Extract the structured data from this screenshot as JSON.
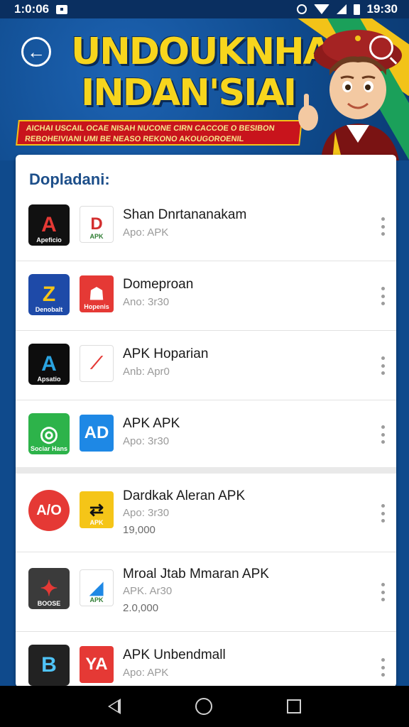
{
  "status_bar": {
    "time_left": "1:0:06",
    "time_right": "19:30"
  },
  "banner": {
    "title_line1": "UNDOUKNHAN",
    "title_line2": "INDAN'SIAI",
    "ribbon_line1": "AICHAI USCAIL OCAE NISAH NUCONE CIRN CACCOE O BESIBON",
    "ribbon_line2": "REBOHEIVIANI UMI BE NEASO REKONO AKOUGOROENIL"
  },
  "list": {
    "title": "Dopladani:",
    "items": [
      {
        "name": "Shan Dnrtananakam",
        "sub": "Apo: APK",
        "size": "",
        "icon_a": {
          "text": "A",
          "caption": "Apeficio",
          "bg": "#111111",
          "fg": "#e53935"
        },
        "icon_b": {
          "text": "D",
          "caption": "APK",
          "bg": "#ffffff",
          "fg": "#d32f2f"
        }
      },
      {
        "name": "Domeproan",
        "sub": "Ano: 3r30",
        "size": "",
        "icon_a": {
          "text": "Z",
          "caption": "Denobalt",
          "bg": "#1e4aa8",
          "fg": "#f5c518"
        },
        "icon_b": {
          "text": "☗",
          "caption": "Hopenis",
          "bg": "#e53935",
          "fg": "#ffffff"
        }
      },
      {
        "name": "APK Hoparian",
        "sub": "Anb: Apr0",
        "size": "",
        "icon_a": {
          "text": "A",
          "caption": "Apsatio",
          "bg": "#0d0d0d",
          "fg": "#2aa3e0"
        },
        "icon_b": {
          "text": "⟋",
          "caption": "",
          "bg": "#ffffff",
          "fg": "#e53935"
        }
      },
      {
        "name": "APK APK",
        "sub": "Apo: 3r30",
        "size": "",
        "icon_a": {
          "text": "◎",
          "caption": "Sociar Hans",
          "bg": "#2db34a",
          "fg": "#ffffff"
        },
        "icon_b": {
          "text": "AD",
          "caption": "",
          "bg": "#1e88e5",
          "fg": "#ffffff"
        }
      },
      {
        "name": "Dardkak Aleran APK",
        "sub": "Apo: 3r30",
        "size": "19,000",
        "icon_a": {
          "text": "A/O",
          "caption": "",
          "bg": "#e53935",
          "fg": "#ffffff"
        },
        "icon_b": {
          "text": "⇄",
          "caption": "APK",
          "bg": "#f5c518",
          "fg": "#111111"
        }
      },
      {
        "name": "Mroal Jtab Mmaran APK",
        "sub": "APK. Ar30",
        "size": "2.0,000",
        "icon_a": {
          "text": "✦",
          "caption": "BOOSE",
          "bg": "#3b3b3b",
          "fg": "#e53935"
        },
        "icon_b": {
          "text": "◢",
          "caption": "APK",
          "bg": "#ffffff",
          "fg": "#1e88e5"
        }
      },
      {
        "name": "APK Unbendmall",
        "sub": "Apo: APK",
        "size": "",
        "icon_a": {
          "text": "B",
          "caption": "",
          "bg": "#222222",
          "fg": "#4fc3f7"
        },
        "icon_b": {
          "text": "YA",
          "caption": "",
          "bg": "#e53935",
          "fg": "#ffffff"
        }
      }
    ]
  },
  "colors": {
    "accent": "#1d4f8a",
    "banner_yellow": "#f7d51d",
    "ribbon_red": "#c8141c"
  }
}
